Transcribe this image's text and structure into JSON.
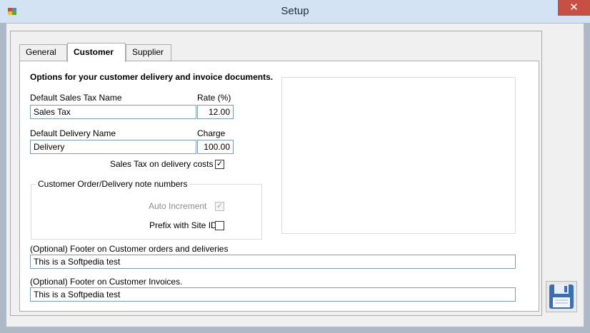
{
  "window": {
    "title": "Setup",
    "close_glyph": "✕"
  },
  "tabs": [
    {
      "label": "General"
    },
    {
      "label": "Customer"
    },
    {
      "label": "Supplier"
    }
  ],
  "customer": {
    "heading": "Options for your customer delivery and invoice documents.",
    "sales_tax_name_label": "Default Sales Tax Name",
    "sales_tax_name_value": "Sales Tax",
    "rate_label": "Rate (%)",
    "rate_value": "12.00",
    "delivery_name_label": "Default Delivery Name",
    "delivery_name_value": "Delivery",
    "charge_label": "Charge",
    "charge_value": "100.00",
    "tax_on_delivery_label": "Sales Tax on delivery costs ?",
    "tax_on_delivery_checked": true,
    "group": {
      "title": "Customer Order/Delivery note numbers",
      "auto_increment_label": "Auto Increment",
      "auto_increment_checked": true,
      "prefix_site_label": "Prefix with Site ID",
      "prefix_site_checked": false
    },
    "footer_orders_label": "(Optional) Footer on Customer orders and deliveries",
    "footer_orders_value": "This is a Softpedia test",
    "footer_invoices_label": "(Optional) Footer on Customer Invoices.",
    "footer_invoices_value": "This is a Softpedia test"
  },
  "icons": {
    "app": "app-icon",
    "save": "floppy-disk-icon"
  }
}
